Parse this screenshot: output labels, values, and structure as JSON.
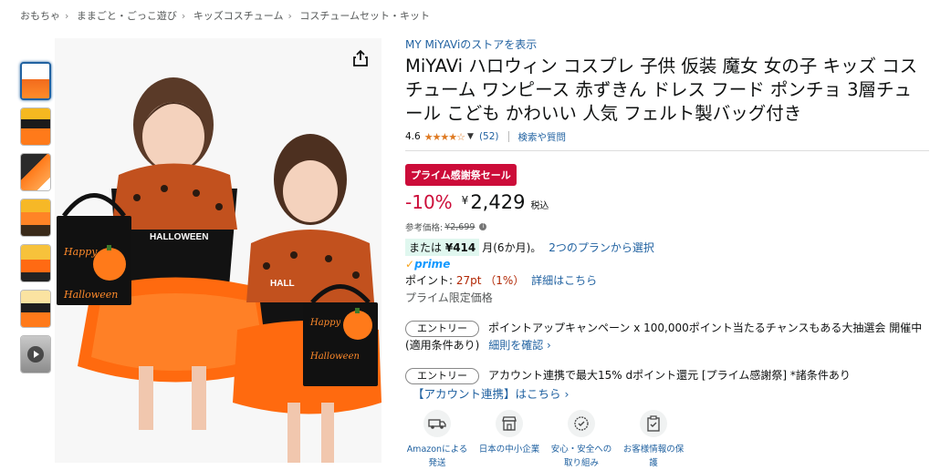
{
  "breadcrumb": [
    "おもちゃ",
    "ままごと・ごっこ遊び",
    "キッズコスチューム",
    "コスチュームセット・キット"
  ],
  "thumbnails": [
    "thumb-1",
    "thumb-2",
    "thumb-3",
    "thumb-4",
    "thumb-5",
    "thumb-6",
    "video"
  ],
  "product": {
    "store_link": "MY MiYAViのストアを表示",
    "title": "MiYAVi ハロウィン コスプレ 子供 仮装 魔女 女の子 キッズ コスチューム ワンピース 赤ずきん ドレス フード ポンチョ 3層チュール こども かわいい 人気 フェルト製バッグ付き",
    "rating": "4.6",
    "stars": "★★★★☆",
    "review_count": "(52)",
    "search_link": "検索や質問"
  },
  "bag_text": {
    "line1": "Happy",
    "line2": "Halloween"
  },
  "dress_text": "HALLOWEEN",
  "dress_text_short": "HALL",
  "price": {
    "sale_badge": "プライム感謝祭セール",
    "discount": "-10%",
    "currency": "¥",
    "amount": "2,429",
    "tax": "税込",
    "ref_label": "参考価格:",
    "ref_price": "¥2,699",
    "installment_prefix": "または",
    "installment_amount": "¥414",
    "installment_suffix": "月(6か月)。",
    "plan_link": "2つのプランから選択",
    "prime_label": "prime",
    "points_label": "ポイント:",
    "points_value": "27pt （1%）",
    "points_link": "詳細はこちら",
    "prime_only": "プライム限定価格"
  },
  "entries": [
    {
      "button": "エントリー",
      "text": "ポイントアップキャンペーン x 100,000ポイント当たるチャンスもある大抽選会 開催中 (適用条件あり)",
      "link": "細則を確認 ›"
    },
    {
      "button": "エントリー",
      "text": "アカウント連携で最大15% dポイント還元 [プライム感謝祭] *諸条件あり",
      "link": "【アカウント連携】はこちら ›"
    }
  ],
  "features": [
    {
      "label": "Amazonによる発送",
      "icon": "delivery-van-icon"
    },
    {
      "label": "日本の中小企業",
      "icon": "storefront-icon"
    },
    {
      "label": "安心・安全への取り組み",
      "icon": "shield-badge-icon"
    },
    {
      "label": "お客様情報の保護",
      "icon": "secure-clipboard-icon"
    }
  ],
  "colors": {
    "link": "#2162a1",
    "sale": "#cc0c39",
    "star": "#de7921",
    "prime": "#1399ff"
  }
}
